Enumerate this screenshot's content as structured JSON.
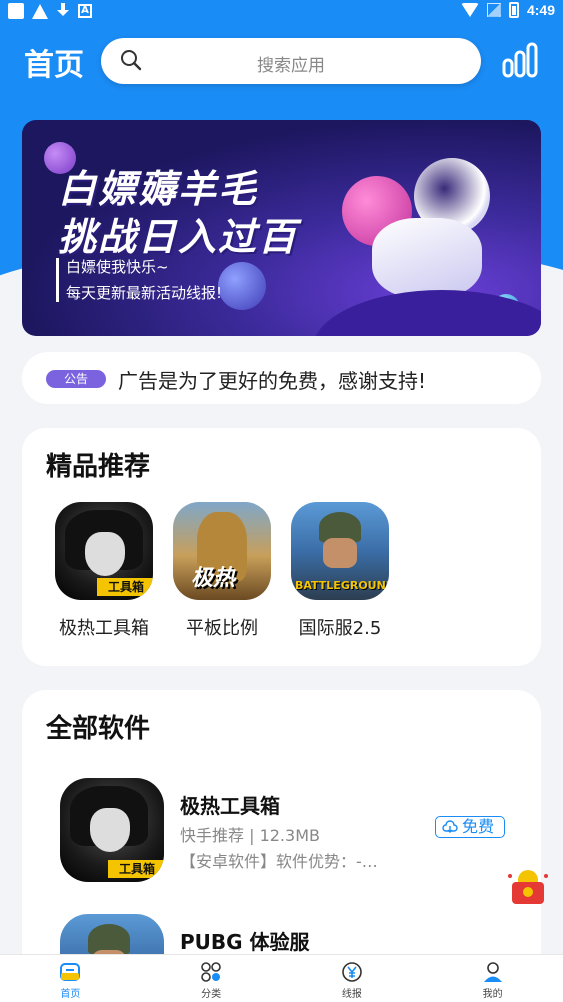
{
  "status_bar": {
    "time": "4:49"
  },
  "header": {
    "title": "首页",
    "search_placeholder": "搜索应用"
  },
  "banner": {
    "title_line1": "白嫖薅羊毛",
    "title_line2": "挑战日入过百",
    "subtitle_line1": "白嫖使我快乐~",
    "subtitle_line2": "每天更新最新活动线报!"
  },
  "notice": {
    "badge": "公告",
    "text": "广告是为了更好的免费，感谢支持!"
  },
  "recommended": {
    "title": "精品推荐",
    "items": [
      {
        "label": "极热工具箱",
        "icon": "anime-avatar-icon",
        "icon_tag": "工具箱"
      },
      {
        "label": "平板比例",
        "icon": "soldier-icon",
        "icon_tag": "极热"
      },
      {
        "label": "国际服2.5",
        "icon": "pubg-icon",
        "icon_tag": "BATTLEGROUNDS"
      }
    ]
  },
  "all_software": {
    "title": "全部软件",
    "apps": [
      {
        "name": "极热工具箱",
        "meta": "快手推荐 | 12.3MB",
        "desc": "【安卓软件】软件优势：-…",
        "button": "免费",
        "icon_tag": "工具箱"
      },
      {
        "name": "PUBG 体验服",
        "meta": "",
        "desc": "",
        "button": ""
      }
    ]
  },
  "bottom_nav": [
    {
      "label": "首页",
      "icon": "home-icon",
      "active": true
    },
    {
      "label": "分类",
      "icon": "grid-icon",
      "active": false
    },
    {
      "label": "线报",
      "icon": "yen-icon",
      "active": false
    },
    {
      "label": "我的",
      "icon": "user-icon",
      "active": false
    }
  ],
  "colors": {
    "primary": "#1a8cf5",
    "badge": "#7b63e0",
    "banner_bg": "#1d1760"
  }
}
